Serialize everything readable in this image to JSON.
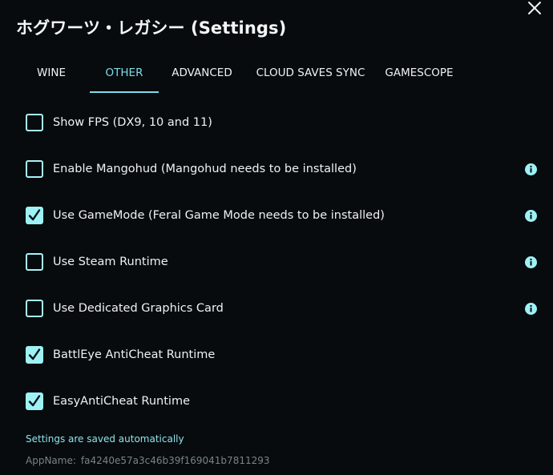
{
  "dialog": {
    "title": "ホグワーツ・レガシー (Settings)",
    "close_icon": "close-icon"
  },
  "tabs": [
    {
      "label": "WINE",
      "active": false
    },
    {
      "label": "OTHER",
      "active": true
    },
    {
      "label": "ADVANCED",
      "active": false
    },
    {
      "label": "CLOUD SAVES SYNC",
      "active": false
    },
    {
      "label": "GAMESCOPE",
      "active": false
    }
  ],
  "options": [
    {
      "label": "Show FPS (DX9, 10 and 11)",
      "checked": false,
      "info": false
    },
    {
      "label": "Enable Mangohud (Mangohud needs to be installed)",
      "checked": false,
      "info": true
    },
    {
      "label": "Use GameMode (Feral Game Mode needs to be installed)",
      "checked": true,
      "info": true
    },
    {
      "label": "Use Steam Runtime",
      "checked": false,
      "info": true
    },
    {
      "label": "Use Dedicated Graphics Card",
      "checked": false,
      "info": true
    },
    {
      "label": "BattlEye AntiCheat Runtime",
      "checked": true,
      "info": false
    },
    {
      "label": "EasyAntiCheat Runtime",
      "checked": true,
      "info": false
    }
  ],
  "footer": {
    "saved_note": "Settings are saved automatically",
    "app_name_label": "AppName:",
    "app_name_value": "fa4240e57a3c46b39f169041b7811293"
  },
  "colors": {
    "background": "#070b0d",
    "accent": "#7fdcea",
    "checkbox": "#9ef1f5",
    "text": "#eef2f3",
    "muted": "#7a8387"
  }
}
